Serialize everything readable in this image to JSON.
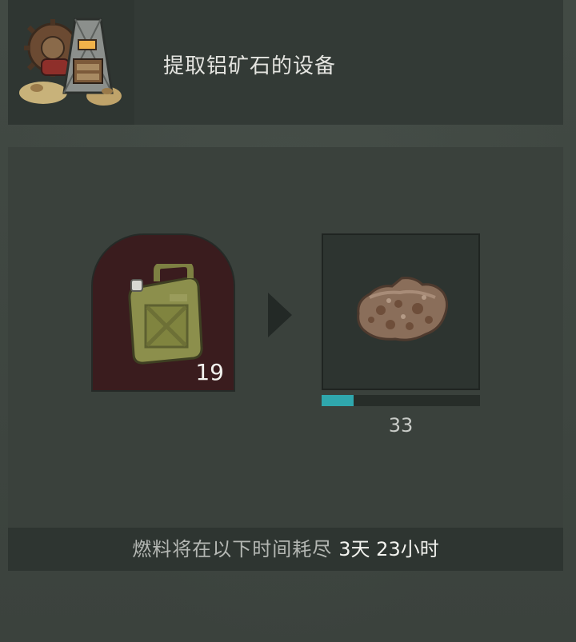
{
  "header": {
    "title": "提取铝矿石的设备",
    "icon": "aluminum-ore-extractor-icon"
  },
  "fuel": {
    "icon": "jerrycan-icon",
    "count": "19",
    "slot_color": "#3a1c1e"
  },
  "output": {
    "icon": "aluminum-ore-icon",
    "count": "33",
    "progress": 0.2,
    "progress_color": "#2fa7ad"
  },
  "footer": {
    "label": "燃料将在以下时间耗尽",
    "time": "3天 23小时"
  }
}
